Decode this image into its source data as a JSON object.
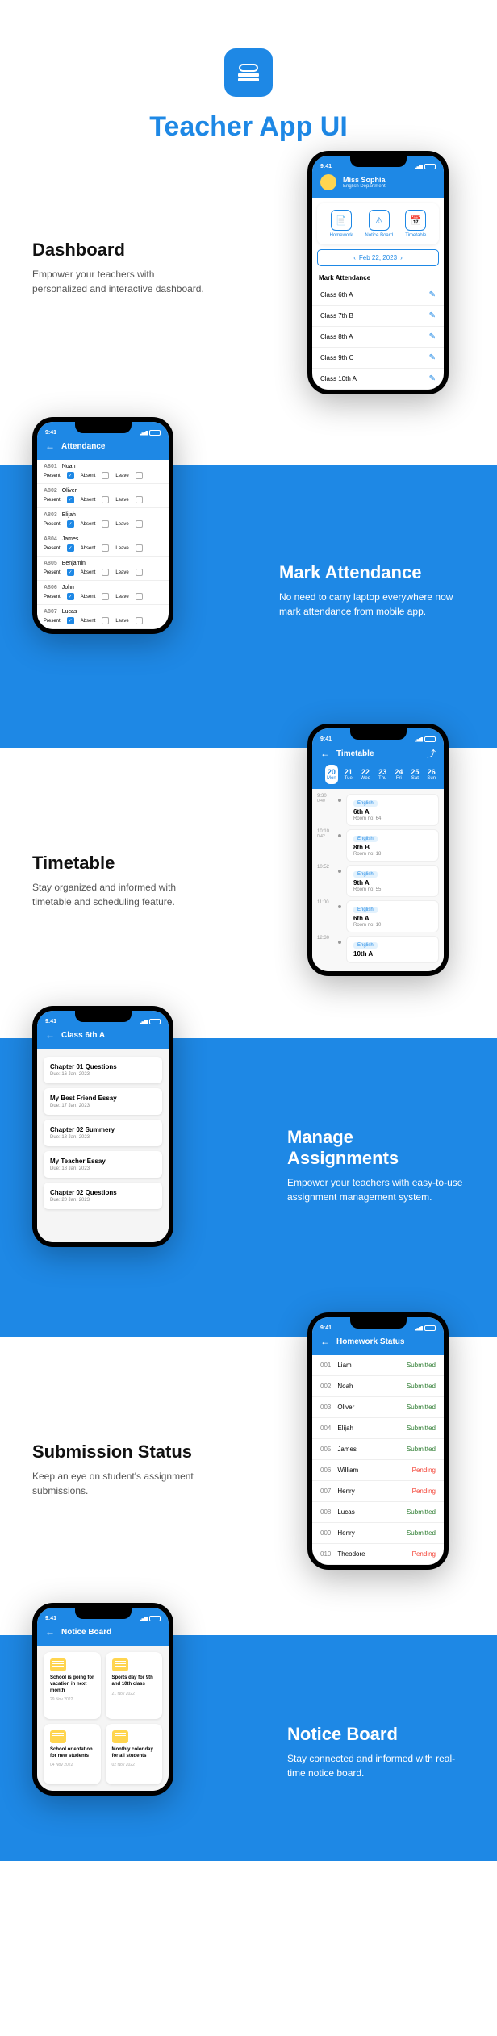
{
  "hero": {
    "title": "Teacher App UI"
  },
  "features": {
    "dashboard": {
      "title": "Dashboard",
      "desc": "Empower your teachers with personalized and interactive dashboard."
    },
    "attendance": {
      "title": "Mark Attendance",
      "desc": "No need to carry laptop everywhere now mark attendance from mobile app."
    },
    "timetable": {
      "title": "Timetable",
      "desc": "Stay organized and informed with timetable and scheduling feature."
    },
    "assignments": {
      "title": "Manage Assignments",
      "desc": "Empower your teachers with easy-to-use assignment management system."
    },
    "submission": {
      "title": "Submission Status",
      "desc": "Keep an eye on student's assignment submissions."
    },
    "notice": {
      "title": "Notice Board",
      "desc": "Stay connected and informed with real-time notice board."
    }
  },
  "dashboard_phone": {
    "time": "9:41",
    "user": "Miss Sophia",
    "dept": "English Department",
    "quick": [
      "Homework",
      "Notice Board",
      "Timetable"
    ],
    "date": "Feb 22, 2023",
    "section": "Mark Attendance",
    "classes": [
      "Class 6th A",
      "Class 7th B",
      "Class 8th A",
      "Class 9th C",
      "Class 10th A"
    ]
  },
  "attendance_phone": {
    "time": "9:41",
    "title": "Attendance",
    "opts": [
      "Present",
      "Absent",
      "Leave"
    ],
    "students": [
      {
        "roll": "A801",
        "name": "Noah"
      },
      {
        "roll": "A802",
        "name": "Oliver"
      },
      {
        "roll": "A803",
        "name": "Elijah"
      },
      {
        "roll": "A804",
        "name": "James"
      },
      {
        "roll": "A805",
        "name": "Benjamin"
      },
      {
        "roll": "A806",
        "name": "John"
      },
      {
        "roll": "A807",
        "name": "Lucas"
      }
    ]
  },
  "timetable_phone": {
    "time": "9:41",
    "title": "Timetable",
    "days": [
      {
        "n": "20",
        "d": "Mon"
      },
      {
        "n": "21",
        "d": "Tue"
      },
      {
        "n": "22",
        "d": "Wed"
      },
      {
        "n": "23",
        "d": "Thu"
      },
      {
        "n": "24",
        "d": "Fri"
      },
      {
        "n": "25",
        "d": "Sat"
      },
      {
        "n": "26",
        "d": "Sun"
      }
    ],
    "slots": [
      {
        "time": "9:30",
        "dur": "0.40",
        "subj": "English",
        "cls": "6th A",
        "room": "Room no: 64"
      },
      {
        "time": "10:10",
        "dur": "0.42",
        "subj": "English",
        "cls": "8th B",
        "room": "Room no: 18"
      },
      {
        "time": "10:52",
        "dur": "",
        "subj": "English",
        "cls": "9th A",
        "room": "Room no: 55"
      },
      {
        "time": "11:00",
        "dur": "",
        "subj": "English",
        "cls": "6th A",
        "room": "Room no: 10"
      },
      {
        "time": "12:30",
        "dur": "",
        "subj": "English",
        "cls": "10th A",
        "room": ""
      }
    ]
  },
  "assignments_phone": {
    "time": "9:41",
    "title": "Class 6th A",
    "items": [
      {
        "t": "Chapter 01 Questions",
        "d": "Due: 16 Jan, 2023"
      },
      {
        "t": "My Best Friend Essay",
        "d": "Due: 17 Jan, 2023"
      },
      {
        "t": "Chapter 02 Summery",
        "d": "Due: 18 Jan, 2023"
      },
      {
        "t": "My Teacher Essay",
        "d": "Due: 18 Jan, 2023"
      },
      {
        "t": "Chapter 02 Questions",
        "d": "Due: 20 Jan, 2023"
      }
    ]
  },
  "submission_phone": {
    "time": "9:41",
    "title": "Homework Status",
    "rows": [
      {
        "no": "001",
        "name": "Liam",
        "status": "Submitted",
        "cls": "submitted"
      },
      {
        "no": "002",
        "name": "Noah",
        "status": "Submitted",
        "cls": "submitted"
      },
      {
        "no": "003",
        "name": "Oliver",
        "status": "Submitted",
        "cls": "submitted"
      },
      {
        "no": "004",
        "name": "Elijah",
        "status": "Submitted",
        "cls": "submitted"
      },
      {
        "no": "005",
        "name": "James",
        "status": "Submitted",
        "cls": "submitted"
      },
      {
        "no": "006",
        "name": "William",
        "status": "Pending",
        "cls": "pending"
      },
      {
        "no": "007",
        "name": "Henry",
        "status": "Pending",
        "cls": "pending"
      },
      {
        "no": "008",
        "name": "Lucas",
        "status": "Submitted",
        "cls": "submitted"
      },
      {
        "no": "009",
        "name": "Henry",
        "status": "Submitted",
        "cls": "submitted"
      },
      {
        "no": "010",
        "name": "Theodore",
        "status": "Pending",
        "cls": "pending"
      }
    ]
  },
  "notice_phone": {
    "time": "9:41",
    "title": "Notice Board",
    "items": [
      {
        "t": "School is going for vacation in next month",
        "d": "29 Nov 2022"
      },
      {
        "t": "Sports day for 9th and 10th class",
        "d": "21 Nov 2022"
      },
      {
        "t": "School orientation for new students",
        "d": "04 Nov 2022"
      },
      {
        "t": "Monthly color day for all students",
        "d": "02 Nov 2022"
      }
    ]
  }
}
